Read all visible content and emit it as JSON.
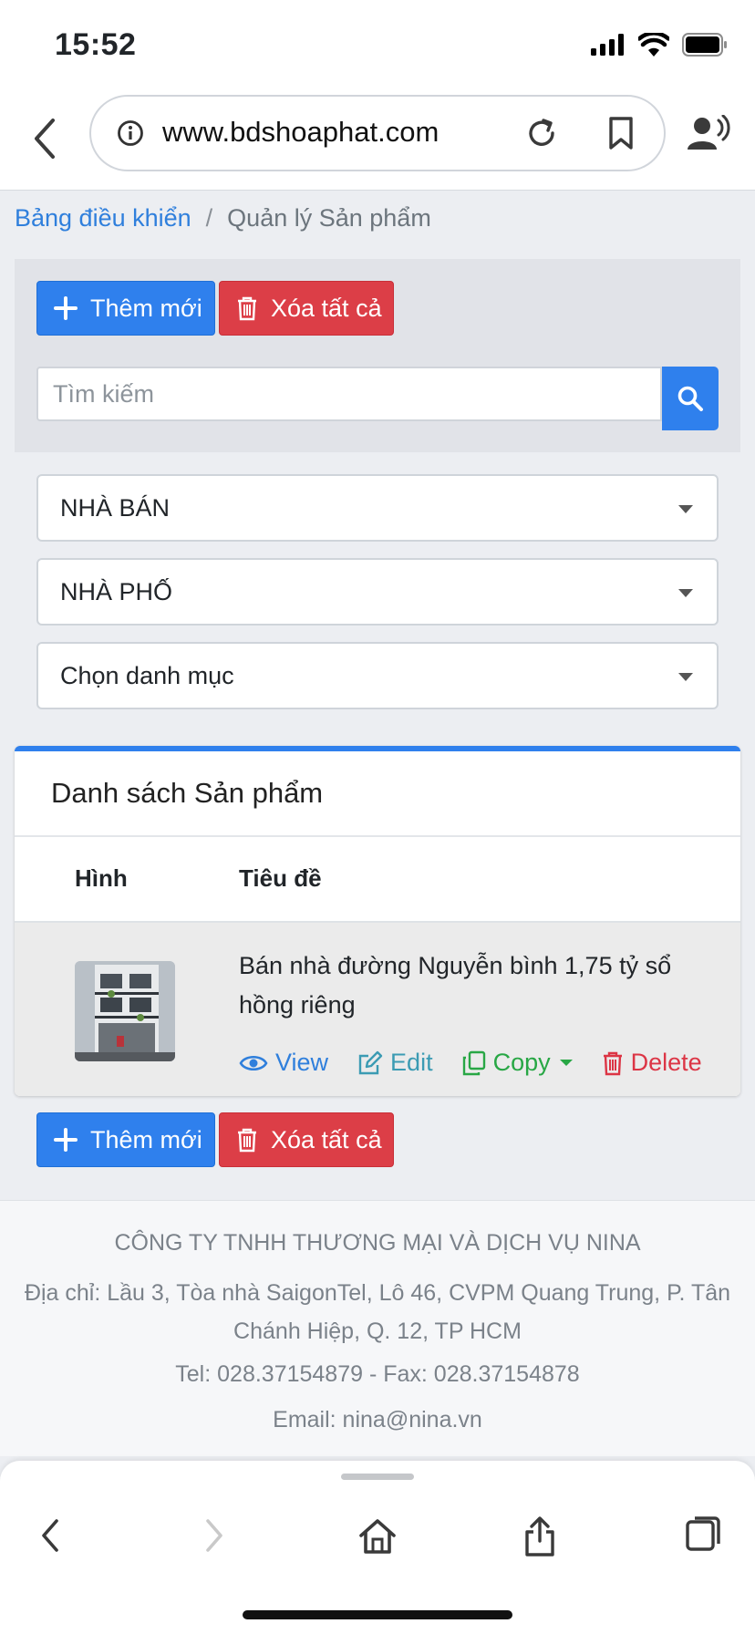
{
  "status_bar": {
    "time": "15:52"
  },
  "browser": {
    "url": "www.bdshoaphat.com"
  },
  "breadcrumb": {
    "home": "Bảng điều khiển",
    "separator": "/",
    "current": "Quản lý Sản phẩm"
  },
  "toolbar": {
    "add_label": "Thêm mới",
    "delete_all_label": "Xóa tất cả",
    "search_placeholder": "Tìm kiếm"
  },
  "filters": {
    "select1": "NHÀ BÁN",
    "select2": "NHÀ PHỐ",
    "select3": "Chọn danh mục"
  },
  "card": {
    "title": "Danh sách Sản phẩm",
    "columns": [
      "Hình",
      "Tiêu đề"
    ],
    "rows": [
      {
        "title": "Bán nhà đường Nguyễn bình 1,75 tỷ sổ hồng riêng",
        "actions": {
          "view": "View",
          "edit": "Edit",
          "copy": "Copy",
          "delete": "Delete"
        }
      }
    ]
  },
  "footer": {
    "company": "CÔNG TY TNHH THƯƠNG MẠI VÀ DỊCH VỤ NINA",
    "address": "Địa chỉ: Lầu 3, Tòa nhà SaigonTel, Lô 46, CVPM Quang Trung, P. Tân Chánh Hiệp, Q. 12, TP HCM",
    "phone": "Tel: 028.37154879 - Fax: 028.37154878",
    "email": "Email: nina@nina.vn"
  },
  "colors": {
    "primary": "#2f80ed",
    "danger": "#dc3e47",
    "success": "#28a745",
    "info": "#3b9bb3"
  },
  "icons": [
    "signal-icon",
    "wifi-icon",
    "battery-icon",
    "back-icon",
    "info-icon",
    "reload-icon",
    "bookmark-icon",
    "speaker-icon",
    "plus-icon",
    "trash-icon",
    "search-icon",
    "eye-icon",
    "edit-icon",
    "copy-icon",
    "home-icon",
    "share-icon",
    "tabs-icon"
  ]
}
